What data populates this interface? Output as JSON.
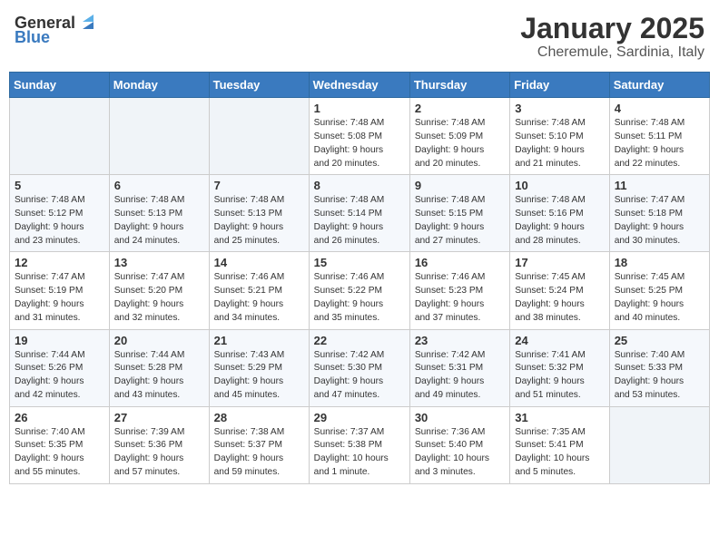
{
  "header": {
    "logo_general": "General",
    "logo_blue": "Blue",
    "title": "January 2025",
    "subtitle": "Cheremule, Sardinia, Italy"
  },
  "weekdays": [
    "Sunday",
    "Monday",
    "Tuesday",
    "Wednesday",
    "Thursday",
    "Friday",
    "Saturday"
  ],
  "weeks": [
    [
      {
        "day": "",
        "info": ""
      },
      {
        "day": "",
        "info": ""
      },
      {
        "day": "",
        "info": ""
      },
      {
        "day": "1",
        "info": "Sunrise: 7:48 AM\nSunset: 5:08 PM\nDaylight: 9 hours\nand 20 minutes."
      },
      {
        "day": "2",
        "info": "Sunrise: 7:48 AM\nSunset: 5:09 PM\nDaylight: 9 hours\nand 20 minutes."
      },
      {
        "day": "3",
        "info": "Sunrise: 7:48 AM\nSunset: 5:10 PM\nDaylight: 9 hours\nand 21 minutes."
      },
      {
        "day": "4",
        "info": "Sunrise: 7:48 AM\nSunset: 5:11 PM\nDaylight: 9 hours\nand 22 minutes."
      }
    ],
    [
      {
        "day": "5",
        "info": "Sunrise: 7:48 AM\nSunset: 5:12 PM\nDaylight: 9 hours\nand 23 minutes."
      },
      {
        "day": "6",
        "info": "Sunrise: 7:48 AM\nSunset: 5:13 PM\nDaylight: 9 hours\nand 24 minutes."
      },
      {
        "day": "7",
        "info": "Sunrise: 7:48 AM\nSunset: 5:13 PM\nDaylight: 9 hours\nand 25 minutes."
      },
      {
        "day": "8",
        "info": "Sunrise: 7:48 AM\nSunset: 5:14 PM\nDaylight: 9 hours\nand 26 minutes."
      },
      {
        "day": "9",
        "info": "Sunrise: 7:48 AM\nSunset: 5:15 PM\nDaylight: 9 hours\nand 27 minutes."
      },
      {
        "day": "10",
        "info": "Sunrise: 7:48 AM\nSunset: 5:16 PM\nDaylight: 9 hours\nand 28 minutes."
      },
      {
        "day": "11",
        "info": "Sunrise: 7:47 AM\nSunset: 5:18 PM\nDaylight: 9 hours\nand 30 minutes."
      }
    ],
    [
      {
        "day": "12",
        "info": "Sunrise: 7:47 AM\nSunset: 5:19 PM\nDaylight: 9 hours\nand 31 minutes."
      },
      {
        "day": "13",
        "info": "Sunrise: 7:47 AM\nSunset: 5:20 PM\nDaylight: 9 hours\nand 32 minutes."
      },
      {
        "day": "14",
        "info": "Sunrise: 7:46 AM\nSunset: 5:21 PM\nDaylight: 9 hours\nand 34 minutes."
      },
      {
        "day": "15",
        "info": "Sunrise: 7:46 AM\nSunset: 5:22 PM\nDaylight: 9 hours\nand 35 minutes."
      },
      {
        "day": "16",
        "info": "Sunrise: 7:46 AM\nSunset: 5:23 PM\nDaylight: 9 hours\nand 37 minutes."
      },
      {
        "day": "17",
        "info": "Sunrise: 7:45 AM\nSunset: 5:24 PM\nDaylight: 9 hours\nand 38 minutes."
      },
      {
        "day": "18",
        "info": "Sunrise: 7:45 AM\nSunset: 5:25 PM\nDaylight: 9 hours\nand 40 minutes."
      }
    ],
    [
      {
        "day": "19",
        "info": "Sunrise: 7:44 AM\nSunset: 5:26 PM\nDaylight: 9 hours\nand 42 minutes."
      },
      {
        "day": "20",
        "info": "Sunrise: 7:44 AM\nSunset: 5:28 PM\nDaylight: 9 hours\nand 43 minutes."
      },
      {
        "day": "21",
        "info": "Sunrise: 7:43 AM\nSunset: 5:29 PM\nDaylight: 9 hours\nand 45 minutes."
      },
      {
        "day": "22",
        "info": "Sunrise: 7:42 AM\nSunset: 5:30 PM\nDaylight: 9 hours\nand 47 minutes."
      },
      {
        "day": "23",
        "info": "Sunrise: 7:42 AM\nSunset: 5:31 PM\nDaylight: 9 hours\nand 49 minutes."
      },
      {
        "day": "24",
        "info": "Sunrise: 7:41 AM\nSunset: 5:32 PM\nDaylight: 9 hours\nand 51 minutes."
      },
      {
        "day": "25",
        "info": "Sunrise: 7:40 AM\nSunset: 5:33 PM\nDaylight: 9 hours\nand 53 minutes."
      }
    ],
    [
      {
        "day": "26",
        "info": "Sunrise: 7:40 AM\nSunset: 5:35 PM\nDaylight: 9 hours\nand 55 minutes."
      },
      {
        "day": "27",
        "info": "Sunrise: 7:39 AM\nSunset: 5:36 PM\nDaylight: 9 hours\nand 57 minutes."
      },
      {
        "day": "28",
        "info": "Sunrise: 7:38 AM\nSunset: 5:37 PM\nDaylight: 9 hours\nand 59 minutes."
      },
      {
        "day": "29",
        "info": "Sunrise: 7:37 AM\nSunset: 5:38 PM\nDaylight: 10 hours\nand 1 minute."
      },
      {
        "day": "30",
        "info": "Sunrise: 7:36 AM\nSunset: 5:40 PM\nDaylight: 10 hours\nand 3 minutes."
      },
      {
        "day": "31",
        "info": "Sunrise: 7:35 AM\nSunset: 5:41 PM\nDaylight: 10 hours\nand 5 minutes."
      },
      {
        "day": "",
        "info": ""
      }
    ]
  ]
}
